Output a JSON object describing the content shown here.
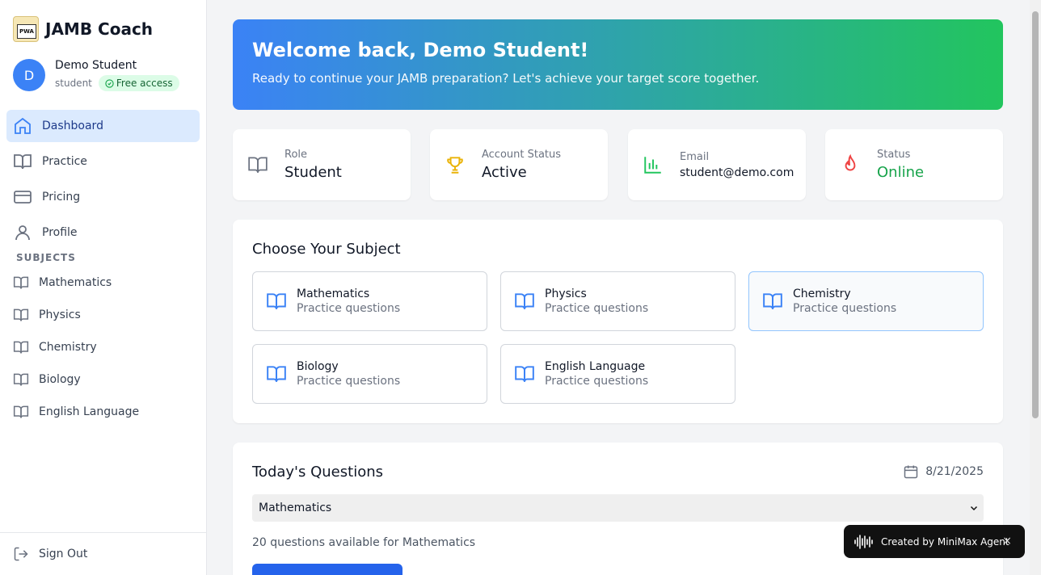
{
  "brand": {
    "name": "JAMB Coach",
    "logo_text": "PWA"
  },
  "user": {
    "initial": "D",
    "name": "Demo Student",
    "role": "student",
    "access_badge": "Free access"
  },
  "nav": [
    {
      "label": "Dashboard",
      "icon": "home-icon"
    },
    {
      "label": "Practice",
      "icon": "book-open-icon"
    },
    {
      "label": "Pricing",
      "icon": "credit-card-icon"
    },
    {
      "label": "Profile",
      "icon": "user-icon"
    }
  ],
  "subjects_heading": "SUBJECTS",
  "subjects_nav": [
    "Mathematics",
    "Physics",
    "Chemistry",
    "Biology",
    "English Language"
  ],
  "sign_out": "Sign Out",
  "hero": {
    "title": "Welcome back, Demo Student!",
    "subtitle": "Ready to continue your JAMB preparation? Let's achieve your target score together."
  },
  "stats": [
    {
      "label": "Role",
      "value": "Student",
      "icon": "book-open-icon"
    },
    {
      "label": "Account Status",
      "value": "Active",
      "icon": "trophy-icon"
    },
    {
      "label": "Email",
      "value": "student@demo.com",
      "icon": "bar-chart-icon"
    },
    {
      "label": "Status",
      "value": "Online",
      "icon": "flame-icon"
    }
  ],
  "choose": {
    "title": "Choose Your Subject",
    "subjects": [
      {
        "name": "Mathematics",
        "desc": "Practice questions"
      },
      {
        "name": "Physics",
        "desc": "Practice questions"
      },
      {
        "name": "Chemistry",
        "desc": "Practice questions"
      },
      {
        "name": "Biology",
        "desc": "Practice questions"
      },
      {
        "name": "English Language",
        "desc": "Practice questions"
      }
    ]
  },
  "today": {
    "title": "Today's Questions",
    "date": "8/21/2025",
    "selected_subject": "Mathematics",
    "available": "20 questions available for Mathematics"
  },
  "toast": {
    "text": "Created by MiniMax Agent",
    "close": "×"
  },
  "colors": {
    "primary": "#3b82f6",
    "accent_green": "#22c55e",
    "status_online": "#16a34a"
  }
}
